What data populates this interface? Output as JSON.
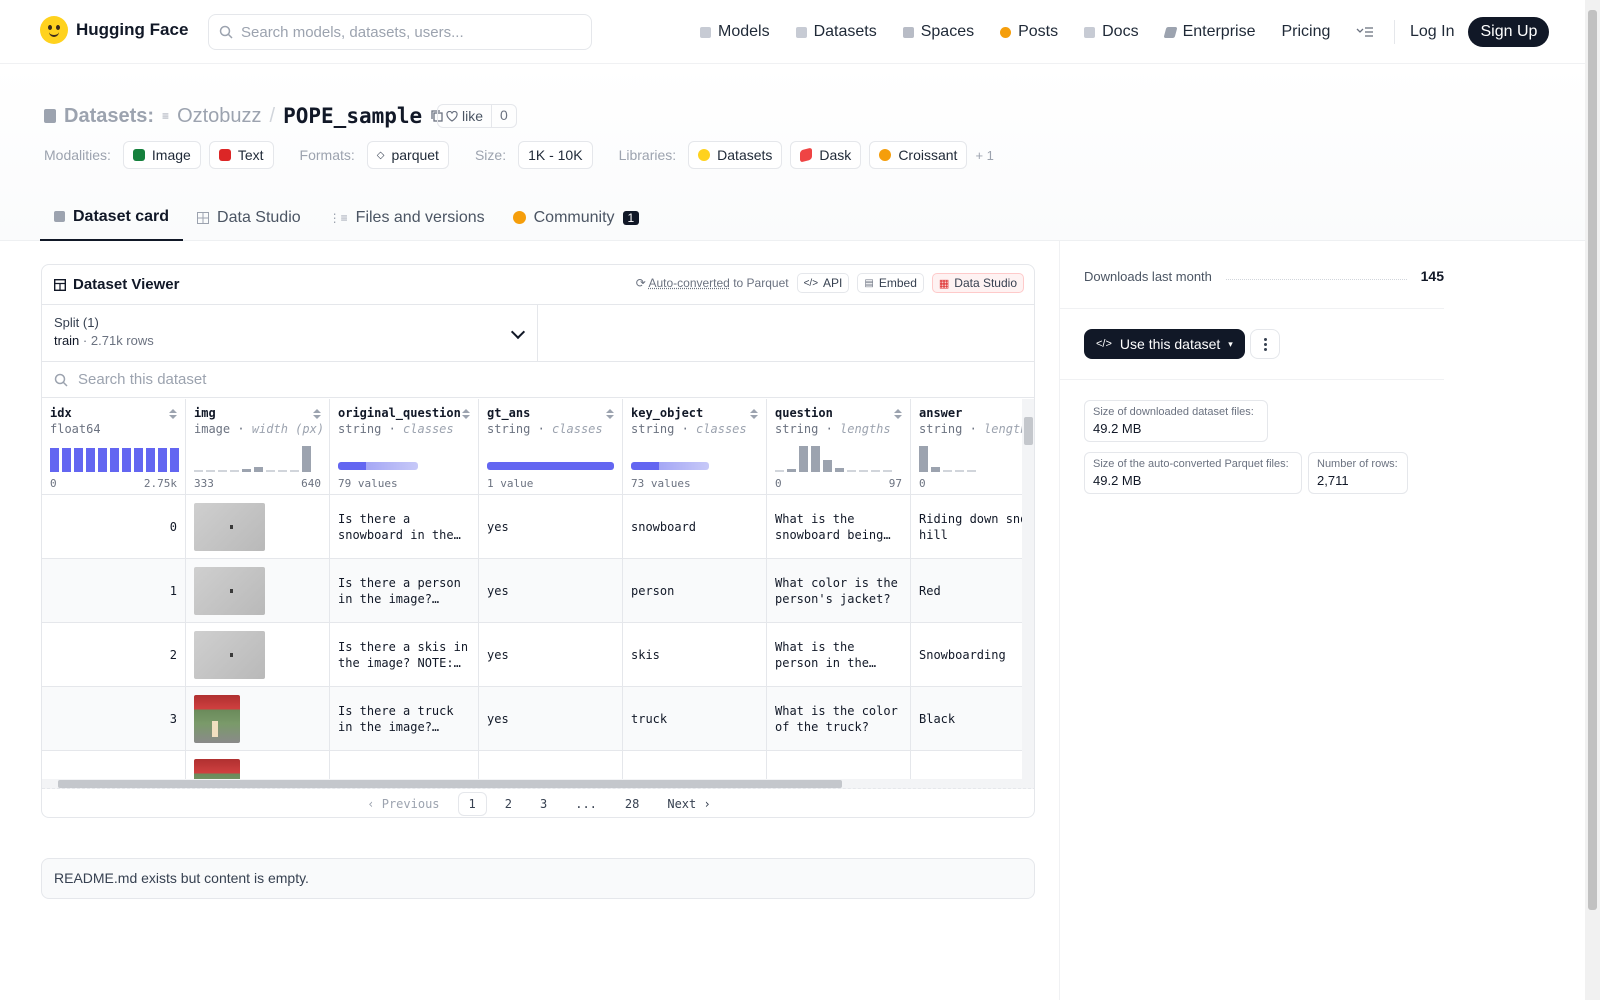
{
  "nav": {
    "brand": "Hugging Face",
    "search_placeholder": "Search models, datasets, users...",
    "links": [
      "Models",
      "Datasets",
      "Spaces",
      "Posts",
      "Docs",
      "Enterprise",
      "Pricing"
    ],
    "login": "Log In",
    "signup": "Sign Up"
  },
  "header": {
    "datasets_label": "Datasets:",
    "owner": "Oztobuzz",
    "repo": "POPE_sample",
    "like_label": "like",
    "like_count": "0",
    "modalities_label": "Modalities:",
    "modalities": [
      "Image",
      "Text"
    ],
    "formats_label": "Formats:",
    "format": "parquet",
    "size_label": "Size:",
    "size": "1K - 10K",
    "libraries_label": "Libraries:",
    "libraries": [
      "Datasets",
      "Dask",
      "Croissant"
    ],
    "libraries_more": "+ 1"
  },
  "tabs": [
    {
      "label": "Dataset card"
    },
    {
      "label": "Data Studio"
    },
    {
      "label": "Files and versions"
    },
    {
      "label": "Community",
      "badge": "1"
    }
  ],
  "viewer": {
    "title": "Dataset Viewer",
    "auto_converted": "Auto-converted",
    "to_parquet": "to Parquet",
    "api": "API",
    "embed": "Embed",
    "data_studio": "Data Studio",
    "split_label": "Split (1)",
    "split_value": "train",
    "split_rows": "2.71k rows",
    "search_placeholder": "Search this dataset",
    "columns": [
      {
        "name": "idx",
        "type": "float64",
        "stat": "",
        "min": "0",
        "max": "2.75k"
      },
      {
        "name": "img",
        "type": "image",
        "stat": "width (px)",
        "min": "333",
        "max": "640"
      },
      {
        "name": "original_question",
        "type": "string",
        "stat": "classes",
        "min": "79 values",
        "max": ""
      },
      {
        "name": "gt_ans",
        "type": "string",
        "stat": "classes",
        "min": "1 value",
        "max": ""
      },
      {
        "name": "key_object",
        "type": "string",
        "stat": "classes",
        "min": "73 values",
        "max": ""
      },
      {
        "name": "question",
        "type": "string",
        "stat": "lengths",
        "min": "0",
        "max": "97"
      },
      {
        "name": "answer",
        "type": "string",
        "stat": "lengths",
        "min": "0",
        "max": ""
      }
    ],
    "rows": [
      {
        "idx": "0",
        "original_question": "Is there a snowboard in the image? NOTE: ...",
        "gt_ans": "yes",
        "key_object": "snowboard",
        "question": "What is the snowboard being used for?",
        "answer": "Riding down snowy hill"
      },
      {
        "idx": "1",
        "original_question": "Is there a person in the image? NOTE: ...",
        "gt_ans": "yes",
        "key_object": "person",
        "question": "What color is the person's jacket?",
        "answer": "Red"
      },
      {
        "idx": "2",
        "original_question": "Is there a skis in the image? NOTE: ...",
        "gt_ans": "yes",
        "key_object": "skis",
        "question": "What is the person in the image doing?",
        "answer": "Snowboarding"
      },
      {
        "idx": "3",
        "original_question": "Is there a truck in the image? NOTE: ...",
        "gt_ans": "yes",
        "key_object": "truck",
        "question": "What is the color of the truck?",
        "answer": "Black"
      }
    ],
    "pager": {
      "prev": "Previous",
      "pages": [
        "1",
        "2",
        "3",
        "...",
        "28"
      ],
      "next": "Next"
    }
  },
  "readme": "README.md exists but content is empty.",
  "sidebar": {
    "downloads_label": "Downloads last month",
    "downloads_value": "145",
    "use_dataset": "Use this dataset",
    "stats": [
      {
        "label": "Size of downloaded dataset files:",
        "value": "49.2 MB"
      },
      {
        "label": "Size of the auto-converted Parquet files:",
        "value": "49.2 MB"
      },
      {
        "label": "Number of rows:",
        "value": "2,711"
      }
    ]
  },
  "colors": {
    "accent": "#6366f1",
    "dark": "#111827",
    "brand": "#ffd21e"
  }
}
